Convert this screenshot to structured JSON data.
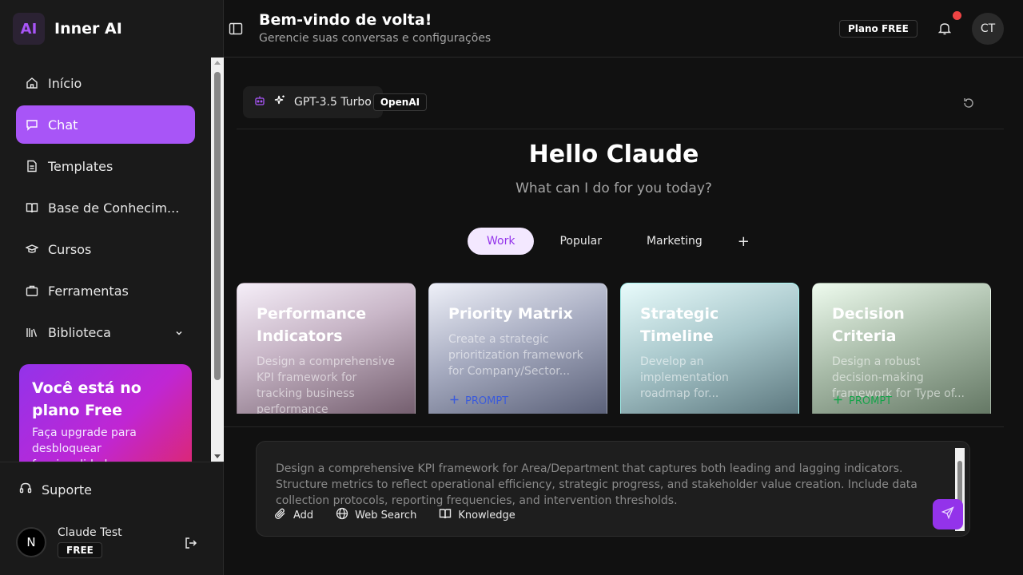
{
  "brand": {
    "logo": "AI",
    "name": "Inner AI"
  },
  "sidebar": {
    "items": [
      {
        "label": "Início",
        "icon": "home-icon"
      },
      {
        "label": "Chat",
        "icon": "message-icon",
        "active": true
      },
      {
        "label": "Templates",
        "icon": "file-icon"
      },
      {
        "label": "Base de Conhecim...",
        "icon": "book-icon"
      },
      {
        "label": "Cursos",
        "icon": "graduation-cap-icon"
      },
      {
        "label": "Ferramentas",
        "icon": "briefcase-icon"
      },
      {
        "label": "Biblioteca",
        "icon": "library-icon",
        "has_chevron": true
      }
    ],
    "upgrade": {
      "title": "Você está no plano Free",
      "text": "Faça upgrade para desbloquear funcionalidades"
    },
    "support_label": "Suporte",
    "user": {
      "avatar": "N",
      "name": "Claude Test",
      "plan": "FREE"
    }
  },
  "header": {
    "title": "Bem-vindo de volta!",
    "subtitle": "Gerencie suas conversas e configurações",
    "plan_badge": "Plano FREE",
    "avatar": "CT"
  },
  "model": {
    "name": "GPT-3.5 Turbo",
    "provider": "OpenAI"
  },
  "greeting": {
    "title": "Hello Claude",
    "subtitle": "What can I do for you today?"
  },
  "tabs": [
    {
      "label": "Work",
      "active": true
    },
    {
      "label": "Popular"
    },
    {
      "label": "Marketing"
    },
    {
      "label": "+"
    }
  ],
  "cards": [
    {
      "title": "Performance Indicators",
      "desc": "Design a comprehensive KPI framework for tracking business performance",
      "prompt": ""
    },
    {
      "title": "Priority Matrix",
      "desc": "Create a strategic prioritization framework for Company/Sector...",
      "prompt": "PROMPT"
    },
    {
      "title": "Strategic Timeline",
      "desc": "Develop an implementation roadmap for...",
      "prompt": ""
    },
    {
      "title": "Decision Criteria",
      "desc": "Design a robust decision-making framework for Type of...",
      "prompt": "PROMPT"
    }
  ],
  "composer": {
    "text": "Design a comprehensive KPI framework for Area/Department that captures both leading and lagging indicators. Structure metrics to reflect operational efficiency, strategic progress, and stakeholder value creation. Include data collection protocols, reporting frequencies, and intervention thresholds.",
    "tools": {
      "add": "Add",
      "web_search": "Web Search",
      "knowledge": "Knowledge"
    }
  },
  "colors": {
    "accent": "#a855f7",
    "background": "#111111",
    "sidebar": "#1a1a1a",
    "notification": "#ef4444"
  }
}
